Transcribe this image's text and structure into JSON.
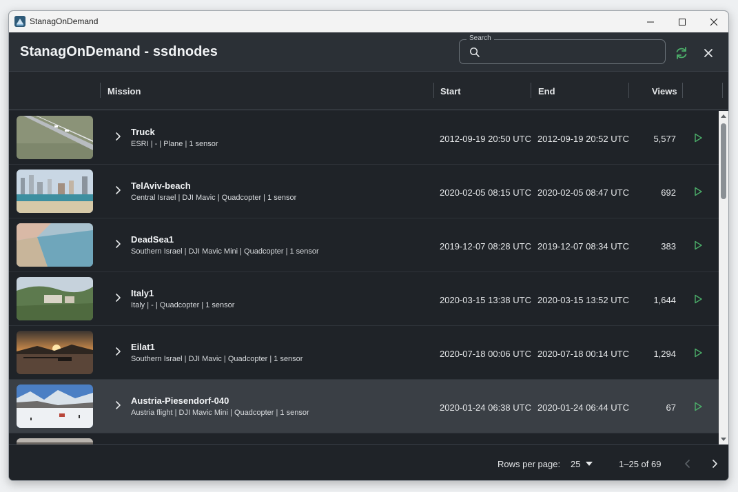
{
  "window": {
    "title": "StanagOnDemand"
  },
  "header": {
    "title": "StanagOnDemand - ssdnodes",
    "search": {
      "label": "Search",
      "value": "",
      "placeholder": ""
    }
  },
  "columns": {
    "mission": "Mission",
    "start": "Start",
    "end": "End",
    "views": "Views"
  },
  "rows": [
    {
      "name": "Truck",
      "desc": "ESRI | - | Plane | 1 sensor",
      "start": "2012-09-19 20:50 UTC",
      "end": "2012-09-19 20:52 UTC",
      "views": "5,577"
    },
    {
      "name": "TelAviv-beach",
      "desc": "Central Israel | DJI Mavic | Quadcopter | 1 sensor",
      "start": "2020-02-05 08:15 UTC",
      "end": "2020-02-05 08:47 UTC",
      "views": "692"
    },
    {
      "name": "DeadSea1",
      "desc": "Southern Israel | DJI Mavic Mini | Quadcopter | 1 sensor",
      "start": "2019-12-07 08:28 UTC",
      "end": "2019-12-07 08:34 UTC",
      "views": "383"
    },
    {
      "name": "Italy1",
      "desc": "Italy | - | Quadcopter | 1 sensor",
      "start": "2020-03-15 13:38 UTC",
      "end": "2020-03-15 13:52 UTC",
      "views": "1,644"
    },
    {
      "name": "Eilat1",
      "desc": "Southern Israel | DJI Mavic | Quadcopter | 1 sensor",
      "start": "2020-07-18 00:06 UTC",
      "end": "2020-07-18 00:14 UTC",
      "views": "1,294"
    },
    {
      "name": "Austria-Piesendorf-040",
      "desc": "Austria flight | DJI Mavic Mini | Quadcopter | 1 sensor",
      "start": "2020-01-24 06:38 UTC",
      "end": "2020-01-24 06:44 UTC",
      "views": "67"
    }
  ],
  "footer": {
    "rows_per_page_label": "Rows per page:",
    "rows_per_page_value": "25",
    "range": "1–25 of 69"
  },
  "icons": {
    "window": [
      "app-icon",
      "minimize-icon",
      "maximize-icon",
      "close-icon"
    ],
    "header": [
      "search-icon",
      "refresh-icon",
      "close-icon"
    ],
    "row": [
      "chevron-right-icon",
      "play-icon"
    ],
    "footer": [
      "caret-down-icon",
      "chevron-left-icon",
      "chevron-right-icon"
    ]
  },
  "colors": {
    "accent_green": "#4caf6a",
    "background": "#1f2328",
    "selected_row": "#3a3f45"
  }
}
